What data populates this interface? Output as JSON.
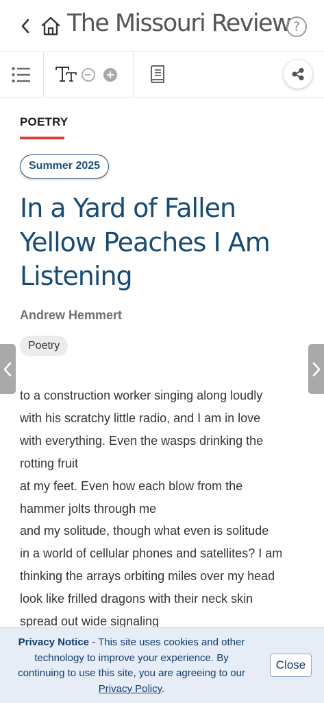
{
  "header": {
    "title": "The Missouri Review",
    "help_glyph": "?",
    "back_icon": "chevron-left-icon",
    "home_icon": "home-icon"
  },
  "toolbar": {
    "toc_icon": "list-icon",
    "font_icon": "text-size-icon",
    "decrease_icon": "minus-circle-icon",
    "increase_icon": "plus-circle-icon",
    "book_icon": "book-icon",
    "share_icon": "share-icon"
  },
  "article": {
    "section": "POETRY",
    "issue": "Summer 2025",
    "title": "In a Yard of Fallen Yellow Peaches I Am Listening",
    "author": "Andrew Hemmert",
    "tag": "Poetry",
    "lines": [
      "to a construction worker singing along loudly",
      "with his scratchy little radio, and I am in love",
      "with everything. Even the wasps drinking the",
      "rotting fruit",
      "at my feet. Even how each blow from the",
      "hammer jolts through me",
      "and my solitude, though what even is solitude",
      "in a world of cellular phones and satellites? I am",
      "thinking the arrays orbiting miles over my head",
      "look like frilled dragons with their neck skin",
      "spread out wide signaling"
    ]
  },
  "privacy": {
    "heading": "Privacy Notice",
    "text_before": " - This site uses cookies and other technology to improve your experience. By continuing to use this site, you are agreeing to our ",
    "link": "Privacy Policy",
    "text_after": ".",
    "close_label": "Close"
  },
  "colors": {
    "accent_red": "#e53935",
    "title_blue": "#174b73",
    "notice_bg": "#e6edf7"
  }
}
